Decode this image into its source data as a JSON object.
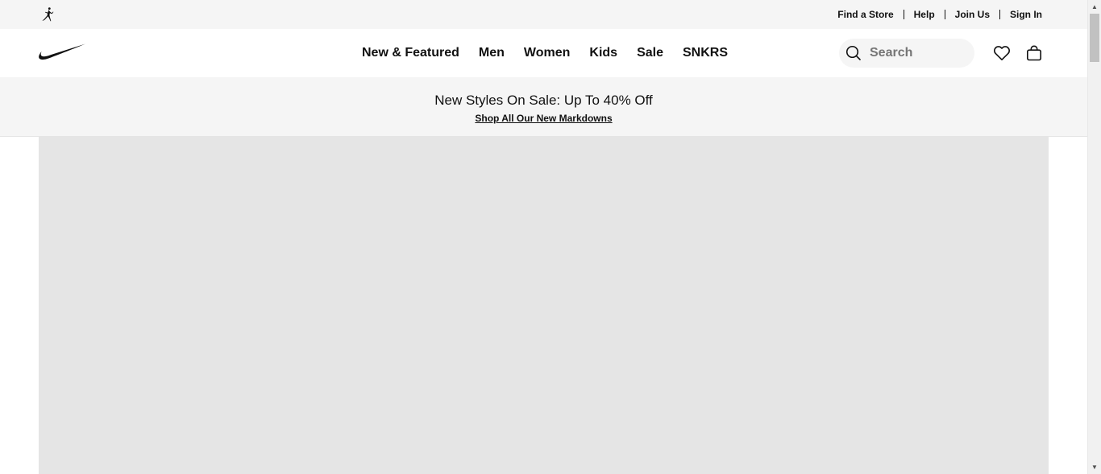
{
  "utility_bar": {
    "logo_icon": "jordan-jumpman-icon",
    "links": [
      "Find a Store",
      "Help",
      "Join Us",
      "Sign In"
    ]
  },
  "header": {
    "logo_icon": "nike-swoosh-icon",
    "nav": [
      "New & Featured",
      "Men",
      "Women",
      "Kids",
      "Sale",
      "SNKRS"
    ],
    "search": {
      "placeholder": "Search",
      "value": "",
      "icon": "search-icon"
    },
    "favorites_icon": "heart-icon",
    "bag_icon": "shopping-bag-icon"
  },
  "promo": {
    "title": "New Styles On Sale: Up To 40% Off",
    "link": "Shop All Our New Markdowns"
  },
  "colors": {
    "utility_bg": "#f5f5f5",
    "hero_placeholder": "#e5e5e5",
    "text": "#111111"
  }
}
